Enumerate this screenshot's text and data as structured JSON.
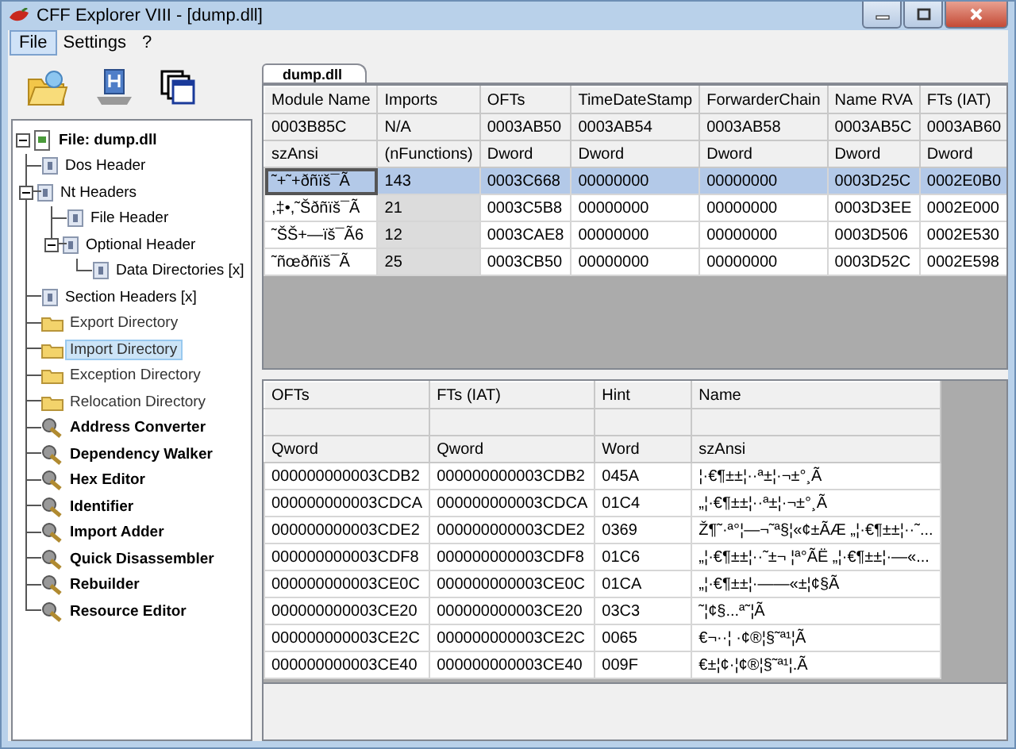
{
  "window": {
    "title": "CFF Explorer VIII - [dump.dll]"
  },
  "menu": [
    {
      "label": "File",
      "selected": true
    },
    {
      "label": "Settings",
      "selected": false
    },
    {
      "label": "?",
      "selected": false
    }
  ],
  "tree": [
    {
      "label": "File: dump.dll",
      "kind": "file",
      "selected": false,
      "expanded": true,
      "children": [
        {
          "label": "Dos Header",
          "kind": "header",
          "selected": false
        },
        {
          "label": "Nt Headers",
          "kind": "header",
          "selected": false,
          "expanded": true,
          "children": [
            {
              "label": "File Header",
              "kind": "header",
              "selected": false
            },
            {
              "label": "Optional Header",
              "kind": "header",
              "selected": false,
              "expanded": true,
              "children": [
                {
                  "label": "Data Directories [x]",
                  "kind": "header",
                  "selected": false
                }
              ]
            }
          ]
        },
        {
          "label": "Section Headers [x]",
          "kind": "header",
          "selected": false
        },
        {
          "label": "Export Directory",
          "kind": "folder",
          "selected": false
        },
        {
          "label": "Import Directory",
          "kind": "folder",
          "selected": true
        },
        {
          "label": "Exception Directory",
          "kind": "folder",
          "selected": false
        },
        {
          "label": "Relocation Directory",
          "kind": "folder",
          "selected": false
        },
        {
          "label": "Address Converter",
          "kind": "tool",
          "selected": false
        },
        {
          "label": "Dependency Walker",
          "kind": "tool",
          "selected": false
        },
        {
          "label": "Hex Editor",
          "kind": "tool",
          "selected": false
        },
        {
          "label": "Identifier",
          "kind": "tool",
          "selected": false
        },
        {
          "label": "Import Adder",
          "kind": "tool",
          "selected": false
        },
        {
          "label": "Quick Disassembler",
          "kind": "tool",
          "selected": false
        },
        {
          "label": "Rebuilder",
          "kind": "tool",
          "selected": false
        },
        {
          "label": "Resource Editor",
          "kind": "tool",
          "selected": false
        }
      ]
    }
  ],
  "tab": {
    "label": "dump.dll",
    "selected": true
  },
  "modules_table": {
    "columns": [
      "Module Name",
      "Imports",
      "OFTs",
      "TimeDateStamp",
      "ForwarderChain",
      "Name RVA",
      "FTs (IAT)"
    ],
    "offsets": [
      "0003B85C",
      "N/A",
      "0003AB50",
      "0003AB54",
      "0003AB58",
      "0003AB5C",
      "0003AB60"
    ],
    "types": [
      "szAnsi",
      "(nFunctions)",
      "Dword",
      "Dword",
      "Dword",
      "Dword",
      "Dword"
    ],
    "rows": [
      {
        "selected": true,
        "cells": [
          "˜+˜+ðñïš¯Ã",
          "143",
          "0003C668",
          "00000000",
          "00000000",
          "0003D25C",
          "0002E0B0"
        ]
      },
      {
        "selected": false,
        "cells": [
          ",‡•,˜Šðñïš¯Ã",
          "21",
          "0003C5B8",
          "00000000",
          "00000000",
          "0003D3EE",
          "0002E000"
        ]
      },
      {
        "selected": false,
        "cells": [
          "˜ŠŠ+—ïš¯Ã6",
          "12",
          "0003CAE8",
          "00000000",
          "00000000",
          "0003D506",
          "0002E530"
        ]
      },
      {
        "selected": false,
        "cells": [
          "˜ñœðñïš¯Ã",
          "25",
          "0003CB50",
          "00000000",
          "00000000",
          "0003D52C",
          "0002E598"
        ]
      }
    ]
  },
  "functions_table": {
    "columns": [
      "OFTs",
      "FTs (IAT)",
      "Hint",
      "Name"
    ],
    "types": [
      "Qword",
      "Qword",
      "Word",
      "szAnsi"
    ],
    "rows": [
      {
        "selected": false,
        "cells": [
          "000000000003CDB2",
          "000000000003CDB2",
          "045A",
          "¦·€¶±±¦··ª±¦·¬±°¸Ã"
        ]
      },
      {
        "selected": false,
        "cells": [
          "000000000003CDCA",
          "000000000003CDCA",
          "01C4",
          "„¦·€¶±±¦··ª±¦·¬±°¸Ã"
        ]
      },
      {
        "selected": false,
        "cells": [
          "000000000003CDE2",
          "000000000003CDE2",
          "0369",
          "Ž¶˜·ª°¦—¬˜ª§¦«¢±ÃÆ „¦·€¶±±¦··˜..."
        ]
      },
      {
        "selected": false,
        "cells": [
          "000000000003CDF8",
          "000000000003CDF8",
          "01C6",
          "„¦·€¶±±¦··˜±¬ ¦ª°ÃË „¦·€¶±±¦·—«..."
        ]
      },
      {
        "selected": false,
        "cells": [
          "000000000003CE0C",
          "000000000003CE0C",
          "01CA",
          "„¦·€¶±±¦·——«±¦¢§Ã"
        ]
      },
      {
        "selected": false,
        "cells": [
          "000000000003CE20",
          "000000000003CE20",
          "03C3",
          "˜¦¢§...ª˜¦Ã"
        ]
      },
      {
        "selected": false,
        "cells": [
          "000000000003CE2C",
          "000000000003CE2C",
          "0065",
          "€¬··¦ ·¢®¦§˜ª¹¦Ã"
        ]
      },
      {
        "selected": false,
        "cells": [
          "000000000003CE40",
          "000000000003CE40",
          "009F",
          "€±¦¢·¦¢®¦§˜ª¹¦.Ã"
        ]
      }
    ]
  }
}
